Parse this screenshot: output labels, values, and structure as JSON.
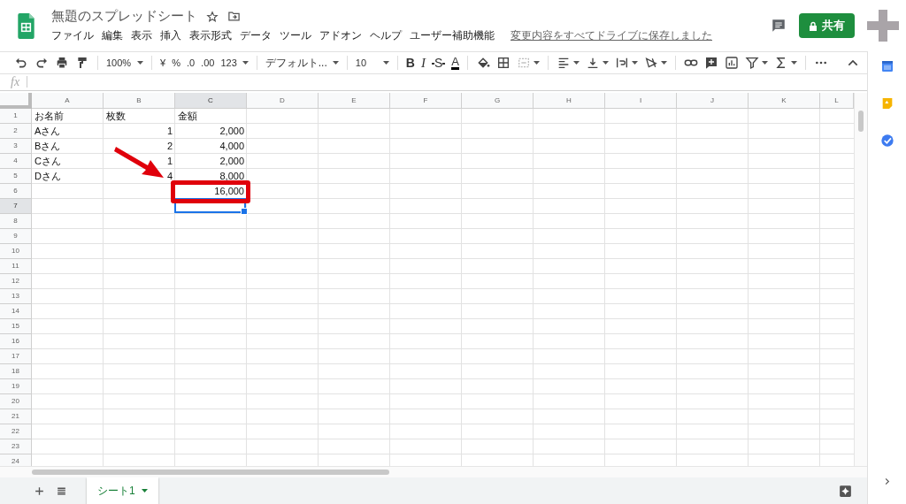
{
  "document": {
    "title": "無題のスプレッドシート",
    "save_status": "変更内容をすべてドライブに保存しました"
  },
  "menu": [
    "ファイル",
    "編集",
    "表示",
    "挿入",
    "表示形式",
    "データ",
    "ツール",
    "アドオン",
    "ヘルプ",
    "ユーザー補助機能"
  ],
  "share_button": {
    "label": "共有"
  },
  "toolbar": [
    {
      "label": "100%",
      "dropdown": true
    },
    {
      "label": "¥",
      "dropdown": false
    },
    {
      "label": "%",
      "dropdown": false
    },
    {
      "label": ".0",
      "dropdown": false
    },
    {
      "label": ".00",
      "dropdown": false
    },
    {
      "label": "123",
      "dropdown": true
    },
    {
      "label": "デフォルト...",
      "dropdown": true
    },
    {
      "label": "10",
      "dropdown": true
    },
    {
      "label": "B",
      "dropdown": false
    },
    {
      "label": "I",
      "dropdown": false
    },
    {
      "label": "S",
      "dropdown": false
    },
    {
      "label": "A",
      "dropdown": false
    }
  ],
  "formula_bar": {
    "label": "fx"
  },
  "columns": [
    {
      "label": "A",
      "selected": false
    },
    {
      "label": "B",
      "selected": false
    },
    {
      "label": "C",
      "selected": true
    },
    {
      "label": "D",
      "selected": false
    },
    {
      "label": "E",
      "selected": false
    },
    {
      "label": "F",
      "selected": false
    },
    {
      "label": "G",
      "selected": false
    },
    {
      "label": "H",
      "selected": false
    },
    {
      "label": "I",
      "selected": false
    },
    {
      "label": "J",
      "selected": false
    },
    {
      "label": "K",
      "selected": false
    },
    {
      "label": "L",
      "selected": false
    }
  ],
  "rows": [
    {
      "number": "1",
      "selected": false,
      "kind": "header",
      "cells": [
        "お名前",
        "枚数",
        "金額"
      ]
    },
    {
      "number": "2",
      "selected": false,
      "kind": "data",
      "cells": [
        "Aさん",
        "1",
        "2,000"
      ]
    },
    {
      "number": "3",
      "selected": false,
      "kind": "data",
      "cells": [
        "Bさん",
        "2",
        "4,000"
      ]
    },
    {
      "number": "4",
      "selected": false,
      "kind": "data",
      "cells": [
        "Cさん",
        "1",
        "2,000"
      ]
    },
    {
      "number": "5",
      "selected": false,
      "kind": "data",
      "cells": [
        "Dさん",
        "4",
        "8,000"
      ]
    },
    {
      "number": "6",
      "selected": false,
      "kind": "data",
      "cells": [
        null,
        null,
        "16,000"
      ]
    },
    {
      "number": "7",
      "selected": true
    },
    {
      "number": "8",
      "selected": false
    },
    {
      "number": "9",
      "selected": false
    },
    {
      "number": "10",
      "selected": false
    },
    {
      "number": "11",
      "selected": false
    },
    {
      "number": "12",
      "selected": false
    },
    {
      "number": "13",
      "selected": false
    },
    {
      "number": "14",
      "selected": false
    },
    {
      "number": "15",
      "selected": false
    },
    {
      "number": "16",
      "selected": false
    },
    {
      "number": "17",
      "selected": false
    },
    {
      "number": "18",
      "selected": false
    },
    {
      "number": "19",
      "selected": false
    },
    {
      "number": "20",
      "selected": false
    },
    {
      "number": "21",
      "selected": false
    },
    {
      "number": "22",
      "selected": false
    },
    {
      "number": "23",
      "selected": false
    },
    {
      "number": "24",
      "selected": false
    }
  ],
  "annotation": {
    "kind": "arrow-and-box"
  },
  "sheet_tabs": [
    {
      "label": "シート1",
      "selected": true
    }
  ]
}
